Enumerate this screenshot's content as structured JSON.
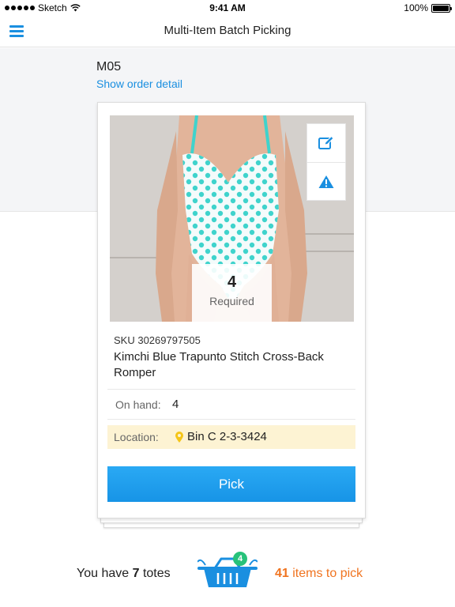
{
  "status_bar": {
    "carrier": "Sketch",
    "time": "9:41 AM",
    "battery": "100%"
  },
  "nav": {
    "title": "Multi-Item Batch Picking",
    "menu_icon": "hamburger-menu-icon"
  },
  "order": {
    "id": "M05",
    "detail_link": "Show order detail"
  },
  "item": {
    "required_count": "4",
    "required_label": "Required",
    "sku": "SKU 30269797505",
    "name": "Kimchi Blue Trapunto Stitch Cross-Back Romper",
    "on_hand_label": "On hand:",
    "on_hand_value": "4",
    "location_label": "Location:",
    "location_value": "Bin C 2-3-3424",
    "actions": [
      "edit-icon",
      "warning-icon"
    ]
  },
  "pick_button": "Pick",
  "footer": {
    "totes_prefix": "You have",
    "totes_count": "7",
    "totes_suffix": "totes",
    "basket_badge": "4",
    "items_count": "41",
    "items_suffix": "items to pick"
  },
  "colors": {
    "accent": "#1a8fe0",
    "pick_button": "#1794e6",
    "location_bg": "#fdf3d3",
    "pin": "#f5c518",
    "items_to_pick": "#f07420",
    "badge": "#27c27a"
  }
}
